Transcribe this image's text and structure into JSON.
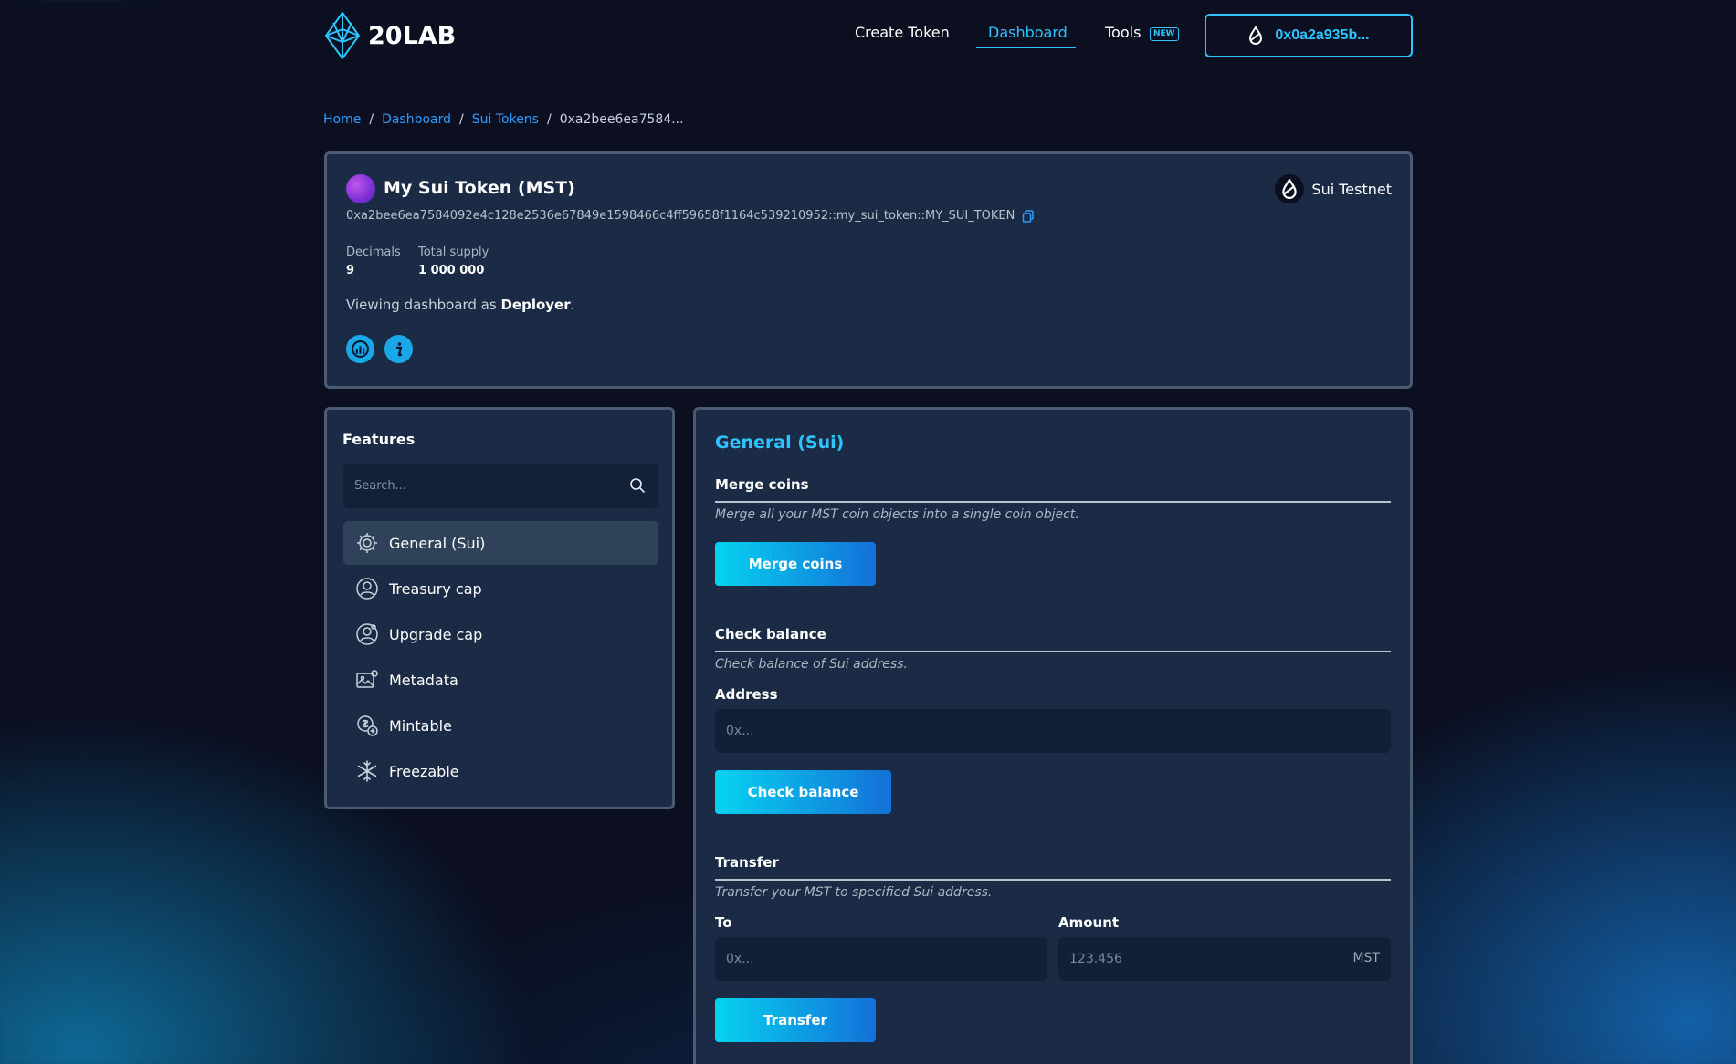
{
  "header": {
    "logo_text": "20LAB",
    "nav": {
      "create_token": "Create Token",
      "dashboard": "Dashboard",
      "tools": "Tools",
      "tools_badge": "NEW"
    },
    "wallet_label": "0x0a2a935b..."
  },
  "breadcrumb": {
    "home": "Home",
    "dashboard": "Dashboard",
    "sui_tokens": "Sui Tokens",
    "current": "0xa2bee6ea7584..."
  },
  "token": {
    "title": "My Sui Token (MST)",
    "network": "Sui Testnet",
    "address": "0xa2bee6ea7584092e4c128e2536e67849e1598466c4ff59658f1164c539210952::my_sui_token::MY_SUI_TOKEN",
    "decimals_label": "Decimals",
    "decimals_value": "9",
    "supply_label": "Total supply",
    "supply_value": "1 000 000",
    "viewing_prefix": "Viewing dashboard as ",
    "viewing_role": "Deployer",
    "viewing_suffix": "."
  },
  "features": {
    "title": "Features",
    "search_placeholder": "Search...",
    "items": [
      {
        "label": "General (Sui)",
        "icon": "gear-icon",
        "selected": true
      },
      {
        "label": "Treasury cap",
        "icon": "user-circle-icon"
      },
      {
        "label": "Upgrade cap",
        "icon": "user-gear-icon"
      },
      {
        "label": "Metadata",
        "icon": "image-gear-icon"
      },
      {
        "label": "Mintable",
        "icon": "coin-plus-icon"
      },
      {
        "label": "Freezable",
        "icon": "snowflake-icon"
      }
    ]
  },
  "general": {
    "title": "General (Sui)",
    "merge": {
      "title": "Merge coins",
      "description": "Merge all your MST coin objects into a single coin object.",
      "button": "Merge coins"
    },
    "balance": {
      "title": "Check balance",
      "description": "Check balance of Sui address.",
      "address_label": "Address",
      "address_placeholder": "0x...",
      "button": "Check balance"
    },
    "transfer": {
      "title": "Transfer",
      "description": "Transfer your MST to specified Sui address.",
      "to_label": "To",
      "to_placeholder": "0x...",
      "amount_label": "Amount",
      "amount_placeholder": "123.456",
      "amount_suffix": "MST",
      "button": "Transfer"
    }
  },
  "colors": {
    "accent": "#2ec4ff",
    "link": "#2e9bff",
    "card": "#1b2b45",
    "background": "#0b0f20"
  }
}
